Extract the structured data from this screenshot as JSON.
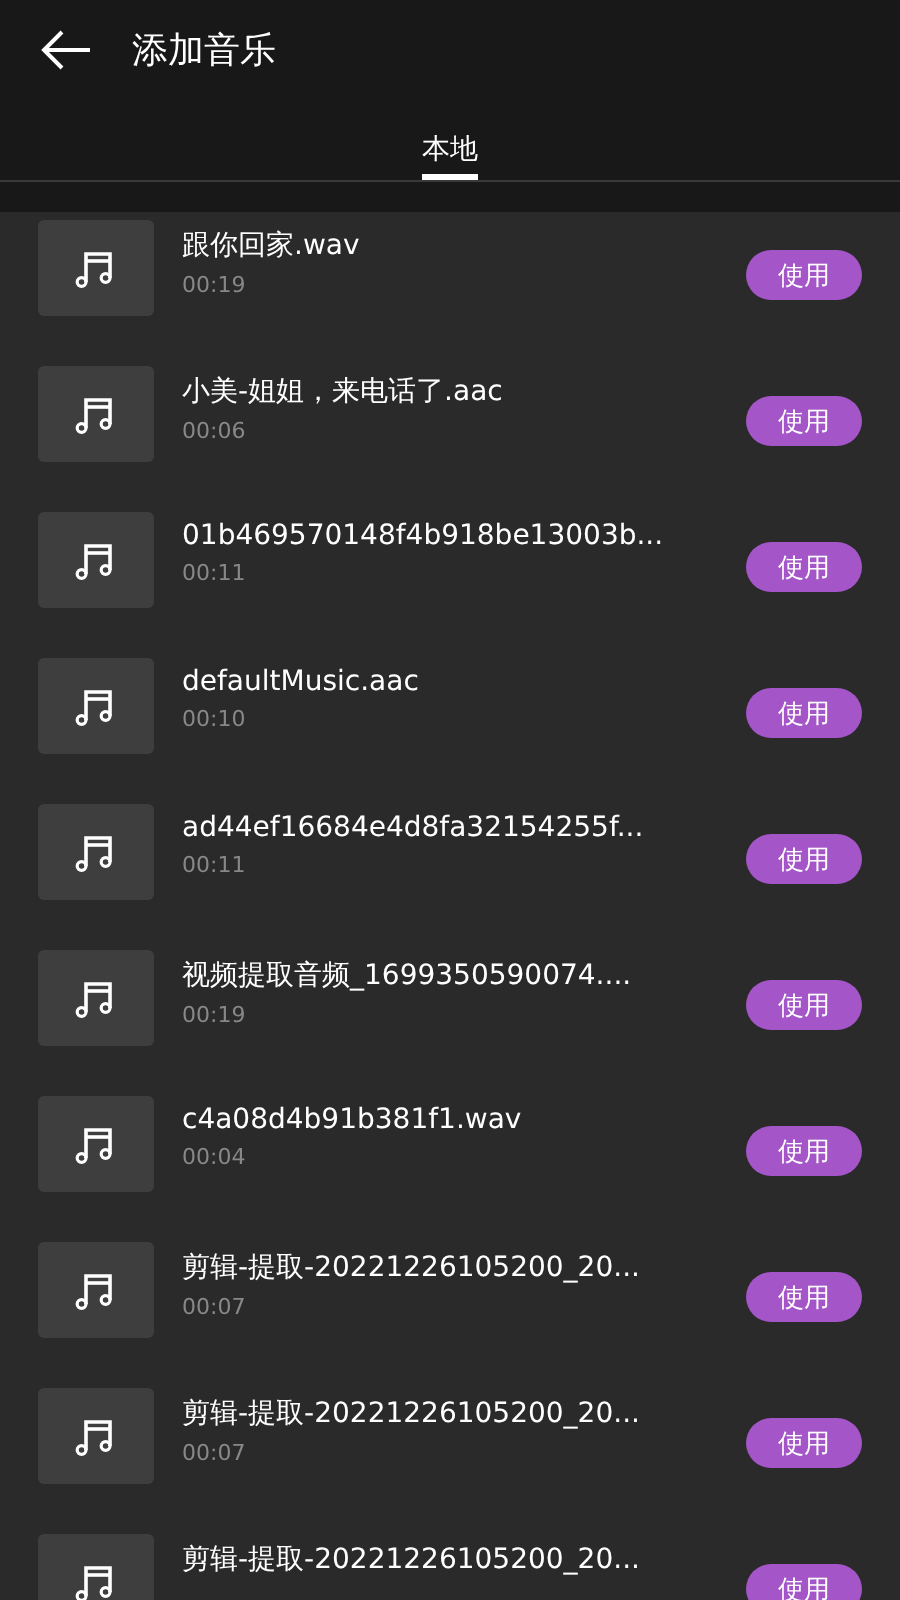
{
  "header": {
    "title": "添加音乐"
  },
  "tabs": [
    {
      "label": "本地",
      "selected": true
    }
  ],
  "tracks": [
    {
      "name": "跟你回家.wav",
      "duration": "00:19",
      "action": "使用"
    },
    {
      "name": "小美-姐姐，来电话了.aac",
      "duration": "00:06",
      "action": "使用"
    },
    {
      "name": "01b469570148f4b918be13003b...",
      "duration": "00:11",
      "action": "使用"
    },
    {
      "name": "defaultMusic.aac",
      "duration": "00:10",
      "action": "使用"
    },
    {
      "name": "ad44ef16684e4d8fa32154255f...",
      "duration": "00:11",
      "action": "使用"
    },
    {
      "name": "视频提取音频_1699350590074....",
      "duration": "00:19",
      "action": "使用"
    },
    {
      "name": "c4a08d4b91b381f1.wav",
      "duration": "00:04",
      "action": "使用"
    },
    {
      "name": "剪辑-提取-20221226105200_20...",
      "duration": "00:07",
      "action": "使用"
    },
    {
      "name": "剪辑-提取-20221226105200_20...",
      "duration": "00:07",
      "action": "使用"
    },
    {
      "name": "剪辑-提取-20221226105200_20...",
      "action": "使用"
    }
  ]
}
